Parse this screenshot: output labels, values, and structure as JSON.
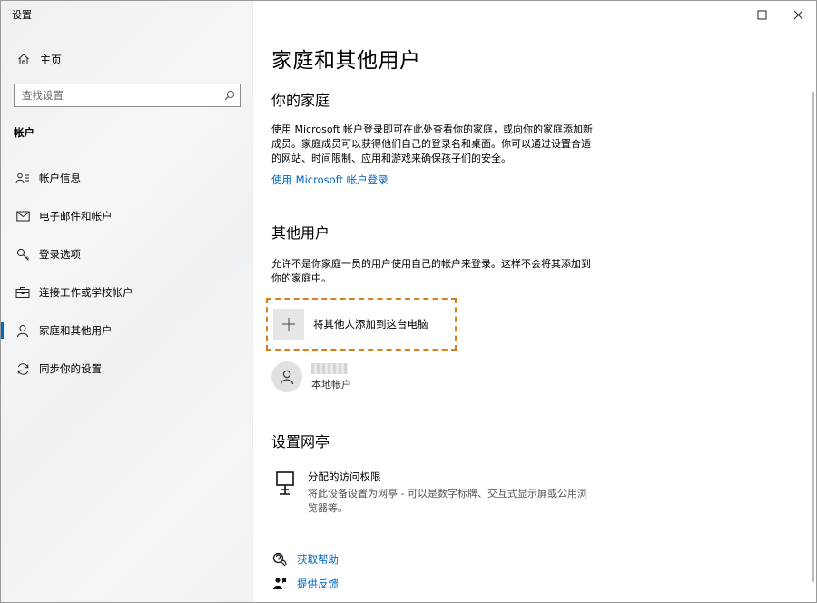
{
  "window": {
    "title": "设置",
    "controls": {
      "minimize": "—",
      "maximize": "☐",
      "close": "✕"
    }
  },
  "sidebar": {
    "home_label": "主页",
    "search_placeholder": "查找设置",
    "section_label": "帐户",
    "items": [
      {
        "label": "帐户信息",
        "icon": "account-info-icon"
      },
      {
        "label": "电子邮件和帐户",
        "icon": "email-icon"
      },
      {
        "label": "登录选项",
        "icon": "key-icon"
      },
      {
        "label": "连接工作或学校帐户",
        "icon": "briefcase-icon"
      },
      {
        "label": "家庭和其他用户",
        "icon": "person-icon",
        "active": true
      },
      {
        "label": "同步你的设置",
        "icon": "sync-icon"
      }
    ],
    "accent_color": "#0067c0"
  },
  "main": {
    "title": "家庭和其他用户",
    "family": {
      "heading": "你的家庭",
      "description_line1": "使用 Microsoft 帐户登录即可在此处查看你的家庭，或向你的家庭添加新",
      "description_line2": "成员。家庭成员可以获得他们自己的登录名和桌面。你可以通过设置合适",
      "description_line3": "的网站、时间限制、应用和游戏来确保孩子们的安全。",
      "link": "使用 Microsoft 帐户登录"
    },
    "others": {
      "heading": "其他用户",
      "description_line1": "允许不是你家庭一员的用户使用自己的帐户来登录。这样不会将其添加到",
      "description_line2": "你的家庭中。",
      "add_label": "将其他人添加到这台电脑",
      "local_user_type": "本地帐户"
    },
    "kiosk": {
      "heading": "设置网亭",
      "title": "分配的访问权限",
      "description_line1": "将此设备设置为网亭 - 可以是数字标牌、交互式显示屏或公用浏",
      "description_line2": "览器等。"
    },
    "help": {
      "get_help": "获取帮助",
      "feedback": "提供反馈"
    },
    "link_color": "#0067c0",
    "highlight_color": "#d97e1b"
  }
}
